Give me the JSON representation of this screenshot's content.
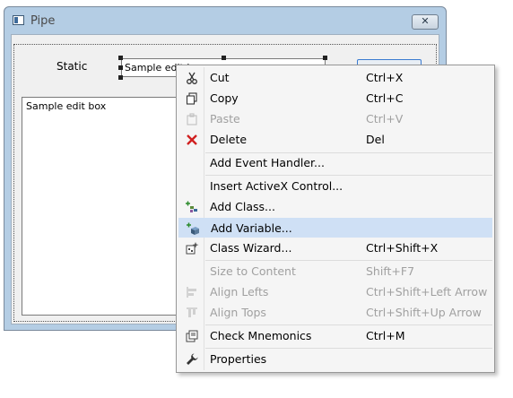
{
  "dialog": {
    "title": "Pipe",
    "close_glyph": "✕"
  },
  "controls": {
    "static_label": "Static",
    "edit_small_text": "Sample edit box",
    "edit_large_text": "Sample edit box"
  },
  "context_menu": {
    "items": [
      {
        "label": "Cut",
        "shortcut": "Ctrl+X",
        "icon": "scissors-icon",
        "disabled": false
      },
      {
        "label": "Copy",
        "shortcut": "Ctrl+C",
        "icon": "copy-icon",
        "disabled": false
      },
      {
        "label": "Paste",
        "shortcut": "Ctrl+V",
        "icon": "paste-icon",
        "disabled": true
      },
      {
        "label": "Delete",
        "shortcut": "Del",
        "icon": "delete-x-icon",
        "disabled": false
      },
      {
        "label": "Add Event Handler...",
        "shortcut": "",
        "icon": "",
        "disabled": false
      },
      {
        "label": "Insert ActiveX Control...",
        "shortcut": "",
        "icon": "",
        "disabled": false
      },
      {
        "label": "Add Class...",
        "shortcut": "",
        "icon": "add-class-icon",
        "disabled": false
      },
      {
        "label": "Add Variable...",
        "shortcut": "",
        "icon": "add-variable-icon",
        "disabled": false,
        "highlighted": true
      },
      {
        "label": "Class Wizard...",
        "shortcut": "Ctrl+Shift+X",
        "icon": "class-wizard-icon",
        "disabled": false
      },
      {
        "label": "Size to Content",
        "shortcut": "Shift+F7",
        "icon": "",
        "disabled": true
      },
      {
        "label": "Align Lefts",
        "shortcut": "Ctrl+Shift+Left Arrow",
        "icon": "align-lefts-icon",
        "disabled": true
      },
      {
        "label": "Align Tops",
        "shortcut": "Ctrl+Shift+Up Arrow",
        "icon": "align-tops-icon",
        "disabled": true
      },
      {
        "label": "Check Mnemonics",
        "shortcut": "Ctrl+M",
        "icon": "check-mnemonics-icon",
        "disabled": false
      },
      {
        "label": "Properties",
        "shortcut": "",
        "icon": "wrench-icon",
        "disabled": false
      }
    ]
  },
  "colors": {
    "highlight": "#cfe0f5",
    "disabled_text": "#a0a0a0",
    "delete_red": "#d02020"
  }
}
